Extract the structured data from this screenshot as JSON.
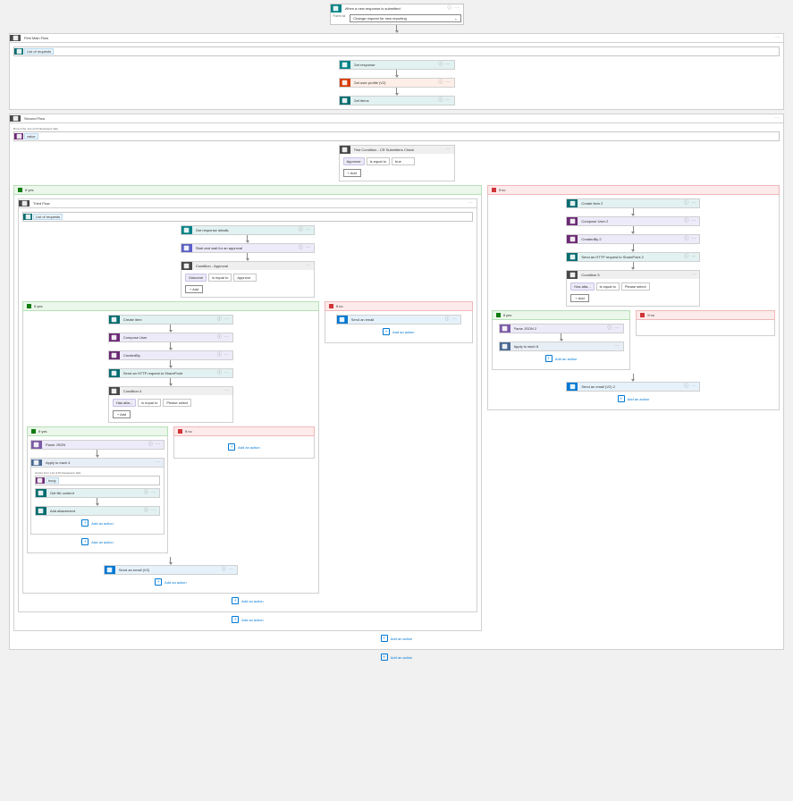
{
  "trigger": {
    "title": "When a new response is submitted",
    "inputLabel": "Form Id",
    "selectValue": "Change request for new reporting",
    "icons": {
      "menu": "⋯",
      "collapse": "⌄"
    }
  },
  "firstScope": {
    "title": "First Main Flow",
    "icon": "scope",
    "runAfterNote": "",
    "slot": {
      "label": "List of requests",
      "icon": "sp"
    },
    "steps": [
      {
        "chip": "forms",
        "title": "Get response",
        "pale": "pale-teal"
      },
      {
        "chip": "o365",
        "title": "Get user profile (V2)",
        "pale": "pale-orange"
      },
      {
        "chip": "sp",
        "title": "Get items",
        "pale": "pale-teal"
      }
    ]
  },
  "secondScope": {
    "title": "Second Flow",
    "runAfterNote": "Runs if the 'List of P1 Reviewers' fails",
    "slot": {
      "label": "value",
      "icon": "var"
    },
    "firstCondition": {
      "title": "First Condition - CR Submitters Check",
      "row": {
        "left": "Approver",
        "op": "is equal to",
        "right": "true"
      },
      "add": "+ Add"
    },
    "yes": {
      "label": "If yes"
    },
    "no": {
      "label": "If no"
    }
  },
  "thirdFlow": {
    "title": "Third Flow",
    "slot": {
      "label": "List of requests",
      "icon": "sp"
    },
    "steps": [
      {
        "chip": "forms",
        "title": "Get response details",
        "pale": "pale-teal"
      },
      {
        "chip": "approv",
        "title": "Start and wait for an approval",
        "pale": "pale-purple"
      }
    ],
    "cond": {
      "title": "Condition - Approval",
      "row": {
        "left": "Outcome",
        "op": "is equal to",
        "right": "Approve"
      },
      "add": "+ Add"
    }
  },
  "innerYes": {
    "label": "If yes",
    "steps": [
      {
        "chip": "sp",
        "title": "Create item",
        "pale": "pale-teal"
      },
      {
        "chip": "var",
        "title": "Compose User",
        "pale": "pale-purple"
      },
      {
        "chip": "var",
        "title": "CreatedBy",
        "pale": "pale-purple"
      },
      {
        "chip": "http",
        "title": "Send an HTTP request to SharePoint",
        "pale": "pale-teal"
      }
    ],
    "cond": {
      "title": "Condition 4",
      "row": {
        "left": "Has atta...",
        "op": "is equal to",
        "right": "Please select"
      },
      "add": "+ Add"
    }
  },
  "innerNo": {
    "label": "If no",
    "steps": [
      {
        "chip": "mail",
        "title": "Send an email",
        "pale": "pale-blue"
      }
    ]
  },
  "deepYes": {
    "label": "If yes",
    "steps": [
      {
        "chip": "parse",
        "title": "Parse JSON",
        "pale": "pale-purple"
      }
    ],
    "loop": {
      "title": "Apply to each 4"
    },
    "loopNote": "Output from 'List of P1 Reviewers' fails",
    "loopSlot": {
      "label": "body",
      "icon": "var"
    },
    "loopSteps": [
      {
        "chip": "sp",
        "title": "Get file content",
        "pale": "pale-teal"
      },
      {
        "chip": "sp",
        "title": "Add attachment",
        "pale": "pale-teal"
      }
    ]
  },
  "deepNo": {
    "label": "If no"
  },
  "afterDeep": {
    "step": {
      "chip": "mail",
      "title": "Send an email (V2)",
      "pale": "pale-blue"
    }
  },
  "rightNo": {
    "label": "If no",
    "steps": [
      {
        "chip": "sp",
        "title": "Create item 2",
        "pale": "pale-teal"
      },
      {
        "chip": "var",
        "title": "Compose User 2",
        "pale": "pale-purple"
      },
      {
        "chip": "var",
        "title": "CreatedBy 2",
        "pale": "pale-purple"
      },
      {
        "chip": "http",
        "title": "Send an HTTP request to SharePoint 2",
        "pale": "pale-teal"
      }
    ],
    "cond": {
      "title": "Condition 5",
      "row": {
        "left": "Has atta...",
        "op": "is equal to",
        "right": "Please select"
      },
      "add": "+ Add"
    }
  },
  "rightDeepYes": {
    "label": "If yes",
    "steps": [
      {
        "chip": "parse",
        "title": "Parse JSON 2",
        "pale": "pale-purple"
      }
    ],
    "loop": {
      "title": "Apply to each 8"
    }
  },
  "rightDeepNo": {
    "label": "If no"
  },
  "rightAfter": {
    "step": {
      "chip": "mail",
      "title": "Send an email (V2) 2",
      "pale": "pale-blue"
    }
  },
  "ui": {
    "addAction": "Add an action",
    "ellipsis": "⋯",
    "chevron": "⌄"
  }
}
